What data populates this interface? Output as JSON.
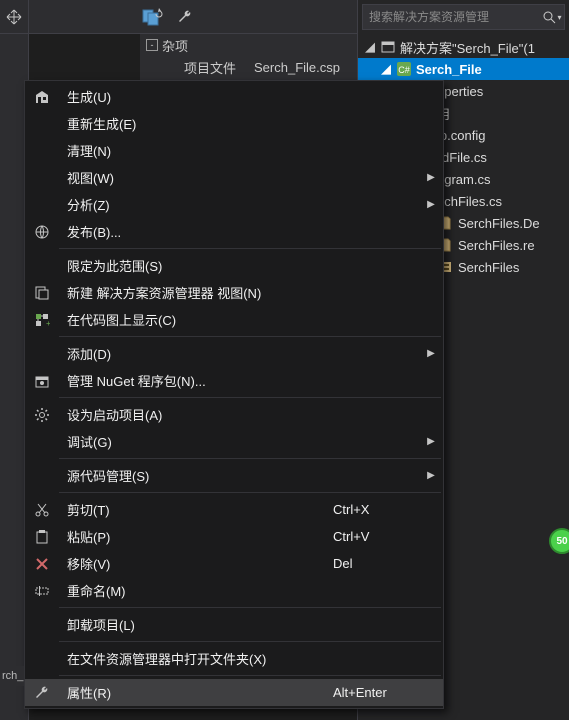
{
  "toolbar": {
    "nav_icon": "nav-arrows-icon",
    "refresh_icon": "refresh-stack-icon",
    "wrench_icon": "wrench-icon"
  },
  "file_header": {
    "group_label": "杂项",
    "col1": "项目文件",
    "col2": "Serch_File.csp"
  },
  "sln": {
    "search_placeholder": "搜索解决方案资源管理",
    "root": "解决方案\"Serch_File\"(1",
    "project": "Serch_File",
    "nodes": [
      "Properties",
      "引用",
      "App.config",
      "FindFile.cs",
      "Program.cs",
      "SerchFiles.cs"
    ],
    "subnodes": [
      "SerchFiles.De",
      "SerchFiles.re",
      "SerchFiles"
    ]
  },
  "menu": {
    "items": [
      {
        "icon": "build-icon",
        "label": "生成(U)",
        "shortcut": "",
        "arrow": false
      },
      {
        "icon": "",
        "label": "重新生成(E)",
        "shortcut": "",
        "arrow": false
      },
      {
        "icon": "",
        "label": "清理(N)",
        "shortcut": "",
        "arrow": false
      },
      {
        "icon": "",
        "label": "视图(W)",
        "shortcut": "",
        "arrow": true
      },
      {
        "icon": "",
        "label": "分析(Z)",
        "shortcut": "",
        "arrow": true
      },
      {
        "icon": "publish-icon",
        "label": "发布(B)...",
        "shortcut": "",
        "arrow": false
      },
      {
        "sep": true
      },
      {
        "icon": "",
        "label": "限定为此范围(S)",
        "shortcut": "",
        "arrow": false
      },
      {
        "icon": "new-view-icon",
        "label": "新建 解决方案资源管理器 视图(N)",
        "shortcut": "",
        "arrow": false
      },
      {
        "icon": "code-map-icon",
        "label": "在代码图上显示(C)",
        "shortcut": "",
        "arrow": false
      },
      {
        "sep": true
      },
      {
        "icon": "",
        "label": "添加(D)",
        "shortcut": "",
        "arrow": true
      },
      {
        "icon": "nuget-icon",
        "label": "管理 NuGet 程序包(N)...",
        "shortcut": "",
        "arrow": false
      },
      {
        "sep": true
      },
      {
        "icon": "gear-icon",
        "label": "设为启动项目(A)",
        "shortcut": "",
        "arrow": false
      },
      {
        "icon": "",
        "label": "调试(G)",
        "shortcut": "",
        "arrow": true
      },
      {
        "sep": true
      },
      {
        "icon": "",
        "label": "源代码管理(S)",
        "shortcut": "",
        "arrow": true
      },
      {
        "sep": true
      },
      {
        "icon": "cut-icon",
        "label": "剪切(T)",
        "shortcut": "Ctrl+X",
        "arrow": false
      },
      {
        "icon": "paste-icon",
        "label": "粘贴(P)",
        "shortcut": "Ctrl+V",
        "arrow": false
      },
      {
        "icon": "remove-icon",
        "label": "移除(V)",
        "shortcut": "Del",
        "arrow": false
      },
      {
        "icon": "rename-icon",
        "label": "重命名(M)",
        "shortcut": "",
        "arrow": false
      },
      {
        "sep": true
      },
      {
        "icon": "",
        "label": "卸载项目(L)",
        "shortcut": "",
        "arrow": false
      },
      {
        "sep": true
      },
      {
        "icon": "",
        "label": "在文件资源管理器中打开文件夹(X)",
        "shortcut": "",
        "arrow": false
      },
      {
        "sep": true
      },
      {
        "icon": "wrench-icon",
        "label": "属性(R)",
        "shortcut": "Alt+Enter",
        "arrow": false,
        "hovered": true
      }
    ]
  },
  "green_badge": "50",
  "bottom_fragment": "rch_"
}
